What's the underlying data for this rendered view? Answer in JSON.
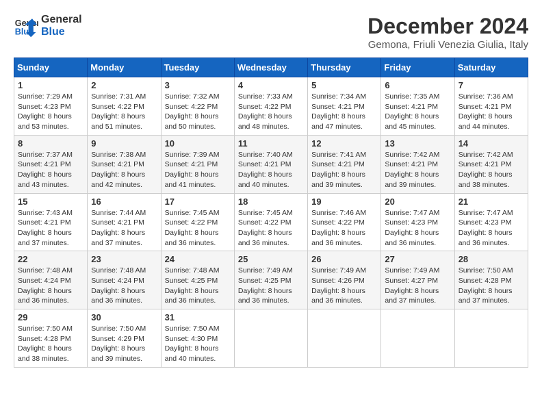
{
  "logo": {
    "line1": "General",
    "line2": "Blue"
  },
  "title": "December 2024",
  "subtitle": "Gemona, Friuli Venezia Giulia, Italy",
  "header": {
    "accent_color": "#1565c0"
  },
  "weekdays": [
    "Sunday",
    "Monday",
    "Tuesday",
    "Wednesday",
    "Thursday",
    "Friday",
    "Saturday"
  ],
  "weeks": [
    [
      {
        "day": "1",
        "sunrise": "7:29 AM",
        "sunset": "4:23 PM",
        "daylight": "8 hours and 53 minutes."
      },
      {
        "day": "2",
        "sunrise": "7:31 AM",
        "sunset": "4:22 PM",
        "daylight": "8 hours and 51 minutes."
      },
      {
        "day": "3",
        "sunrise": "7:32 AM",
        "sunset": "4:22 PM",
        "daylight": "8 hours and 50 minutes."
      },
      {
        "day": "4",
        "sunrise": "7:33 AM",
        "sunset": "4:22 PM",
        "daylight": "8 hours and 48 minutes."
      },
      {
        "day": "5",
        "sunrise": "7:34 AM",
        "sunset": "4:21 PM",
        "daylight": "8 hours and 47 minutes."
      },
      {
        "day": "6",
        "sunrise": "7:35 AM",
        "sunset": "4:21 PM",
        "daylight": "8 hours and 45 minutes."
      },
      {
        "day": "7",
        "sunrise": "7:36 AM",
        "sunset": "4:21 PM",
        "daylight": "8 hours and 44 minutes."
      }
    ],
    [
      {
        "day": "8",
        "sunrise": "7:37 AM",
        "sunset": "4:21 PM",
        "daylight": "8 hours and 43 minutes."
      },
      {
        "day": "9",
        "sunrise": "7:38 AM",
        "sunset": "4:21 PM",
        "daylight": "8 hours and 42 minutes."
      },
      {
        "day": "10",
        "sunrise": "7:39 AM",
        "sunset": "4:21 PM",
        "daylight": "8 hours and 41 minutes."
      },
      {
        "day": "11",
        "sunrise": "7:40 AM",
        "sunset": "4:21 PM",
        "daylight": "8 hours and 40 minutes."
      },
      {
        "day": "12",
        "sunrise": "7:41 AM",
        "sunset": "4:21 PM",
        "daylight": "8 hours and 39 minutes."
      },
      {
        "day": "13",
        "sunrise": "7:42 AM",
        "sunset": "4:21 PM",
        "daylight": "8 hours and 39 minutes."
      },
      {
        "day": "14",
        "sunrise": "7:42 AM",
        "sunset": "4:21 PM",
        "daylight": "8 hours and 38 minutes."
      }
    ],
    [
      {
        "day": "15",
        "sunrise": "7:43 AM",
        "sunset": "4:21 PM",
        "daylight": "8 hours and 37 minutes."
      },
      {
        "day": "16",
        "sunrise": "7:44 AM",
        "sunset": "4:21 PM",
        "daylight": "8 hours and 37 minutes."
      },
      {
        "day": "17",
        "sunrise": "7:45 AM",
        "sunset": "4:22 PM",
        "daylight": "8 hours and 36 minutes."
      },
      {
        "day": "18",
        "sunrise": "7:45 AM",
        "sunset": "4:22 PM",
        "daylight": "8 hours and 36 minutes."
      },
      {
        "day": "19",
        "sunrise": "7:46 AM",
        "sunset": "4:22 PM",
        "daylight": "8 hours and 36 minutes."
      },
      {
        "day": "20",
        "sunrise": "7:47 AM",
        "sunset": "4:23 PM",
        "daylight": "8 hours and 36 minutes."
      },
      {
        "day": "21",
        "sunrise": "7:47 AM",
        "sunset": "4:23 PM",
        "daylight": "8 hours and 36 minutes."
      }
    ],
    [
      {
        "day": "22",
        "sunrise": "7:48 AM",
        "sunset": "4:24 PM",
        "daylight": "8 hours and 36 minutes."
      },
      {
        "day": "23",
        "sunrise": "7:48 AM",
        "sunset": "4:24 PM",
        "daylight": "8 hours and 36 minutes."
      },
      {
        "day": "24",
        "sunrise": "7:48 AM",
        "sunset": "4:25 PM",
        "daylight": "8 hours and 36 minutes."
      },
      {
        "day": "25",
        "sunrise": "7:49 AM",
        "sunset": "4:25 PM",
        "daylight": "8 hours and 36 minutes."
      },
      {
        "day": "26",
        "sunrise": "7:49 AM",
        "sunset": "4:26 PM",
        "daylight": "8 hours and 36 minutes."
      },
      {
        "day": "27",
        "sunrise": "7:49 AM",
        "sunset": "4:27 PM",
        "daylight": "8 hours and 37 minutes."
      },
      {
        "day": "28",
        "sunrise": "7:50 AM",
        "sunset": "4:28 PM",
        "daylight": "8 hours and 37 minutes."
      }
    ],
    [
      {
        "day": "29",
        "sunrise": "7:50 AM",
        "sunset": "4:28 PM",
        "daylight": "8 hours and 38 minutes."
      },
      {
        "day": "30",
        "sunrise": "7:50 AM",
        "sunset": "4:29 PM",
        "daylight": "8 hours and 39 minutes."
      },
      {
        "day": "31",
        "sunrise": "7:50 AM",
        "sunset": "4:30 PM",
        "daylight": "8 hours and 40 minutes."
      },
      null,
      null,
      null,
      null
    ]
  ]
}
